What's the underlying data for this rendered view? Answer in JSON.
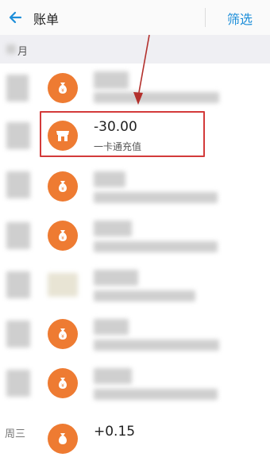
{
  "header": {
    "title": "账单",
    "filter_label": "筛选"
  },
  "section": {
    "label": "月"
  },
  "highlighted_record": {
    "amount": "-30.00",
    "description": "一卡通充值"
  },
  "last_row": {
    "day": "周三",
    "amount": "+0.15"
  },
  "colors": {
    "accent": "#1d8ed9",
    "icon_bg": "#ee7b32",
    "highlight_border": "#d33a3a"
  },
  "icons": {
    "back": "arrow-left-icon",
    "money_bag": "money-bag-icon",
    "store": "store-icon"
  }
}
